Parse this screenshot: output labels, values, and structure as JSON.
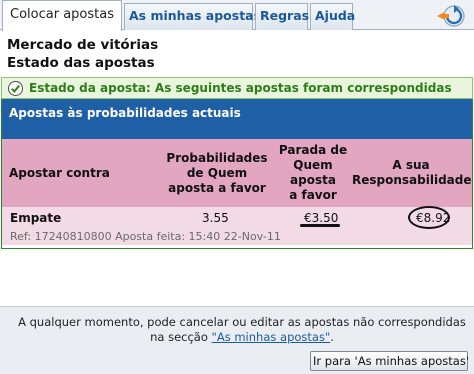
{
  "tabs": [
    {
      "label": "Colocar apostas",
      "active": true
    },
    {
      "label": "As minhas apostas",
      "active": false
    },
    {
      "label": "Regras",
      "active": false
    },
    {
      "label": "Ajuda",
      "active": false
    }
  ],
  "header": {
    "market": "Mercado de vitórias",
    "status_title": "Estado das apostas"
  },
  "status": {
    "text": "Estado da aposta: As seguintes apostas foram correspondidas"
  },
  "section": {
    "title": "Apostas às probabilidades actuais"
  },
  "columns": {
    "against": "Apostar contra",
    "odds_line1": "Probabilidades",
    "odds_line2": "de Quem",
    "odds_line3": "aposta a favor",
    "stake_line1": "Parada de",
    "stake_line2": "Quem",
    "stake_line3": "aposta",
    "stake_line4": "a favor",
    "liab_line1": "A sua",
    "liab_line2": "Responsabilidade"
  },
  "bet": {
    "selection": "Empate",
    "odds": "3.55",
    "stake": "€3.50",
    "liability": "€8.92",
    "ref": "Ref: 17240810800 Aposta feita: 15:40 22-Nov-11"
  },
  "footer": {
    "info_text": "A qualquer momento, pode cancelar ou editar as apostas não correspondidas na secção",
    "info_link": "\"As minhas apostas\"",
    "info_end": ".",
    "goto_button": "Ir para 'As minhas apostas'"
  },
  "colors": {
    "tab_text": "#1a5a9b",
    "section_header": "#1f5fa6",
    "column_header": "#e3a6c1",
    "row_bg": "#f3dbe6",
    "status_bg": "#e9f6dd",
    "status_text": "#2e7d19"
  },
  "icons": {
    "home": "refresh-home-icon",
    "status": "check-icon"
  }
}
